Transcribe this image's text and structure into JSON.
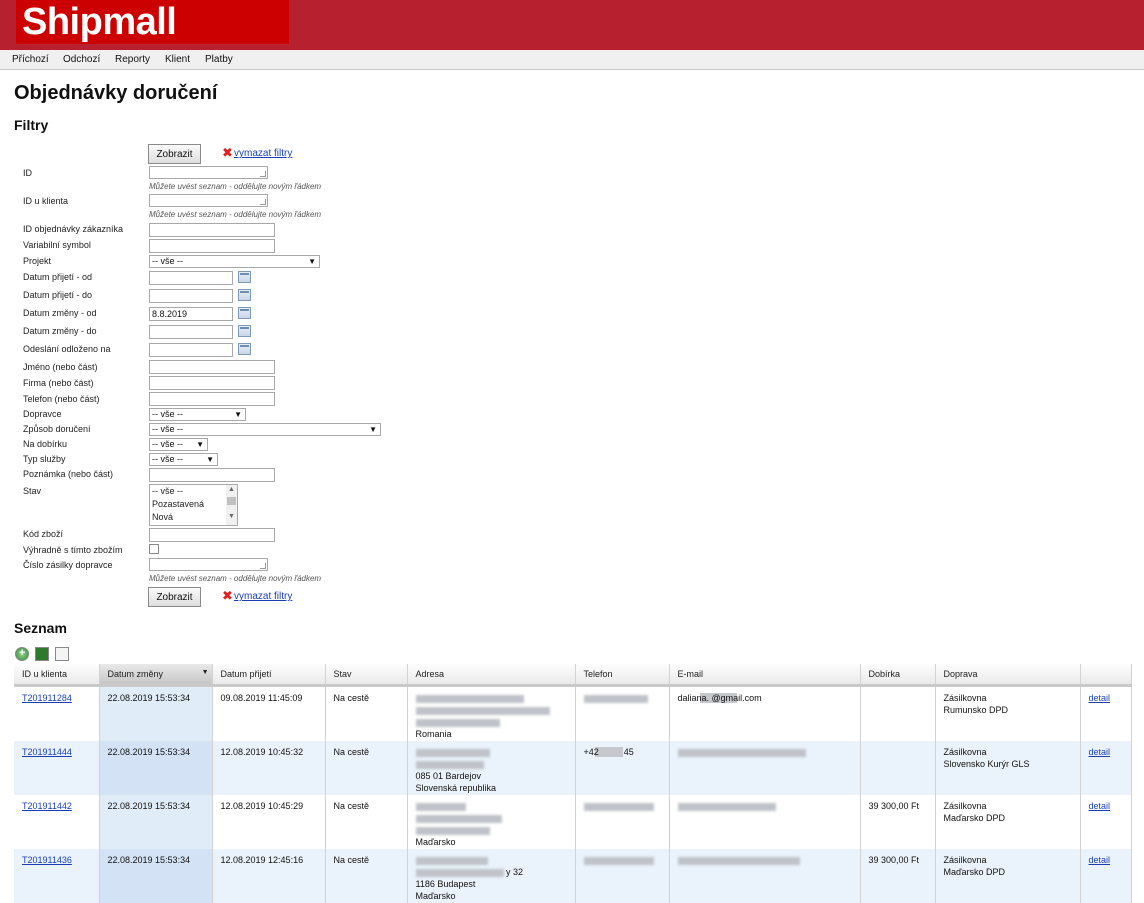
{
  "app": {
    "logo": "Shipmall"
  },
  "nav": [
    "Příchozí",
    "Odchozí",
    "Reporty",
    "Klient",
    "Platby"
  ],
  "page_title": "Objednávky doručení",
  "filters": {
    "heading": "Filtry",
    "show_button": "Zobrazit",
    "clear_link": "vymazat filtry",
    "list_hint": "Můžete uvést seznam - oddělujte novým řádkem",
    "labels": {
      "id": "ID",
      "client_id": "ID u klienta",
      "customer_order_id": "ID objednávky zákazníka",
      "variable_symbol": "Variabilní symbol",
      "project": "Projekt",
      "received_from": "Datum přijetí - od",
      "received_to": "Datum přijetí - do",
      "changed_from": "Datum změny - od",
      "changed_to": "Datum změny - do",
      "shipping_postponed": "Odeslání odloženo na",
      "name": "Jméno (nebo část)",
      "company": "Firma (nebo část)",
      "phone": "Telefon (nebo část)",
      "carrier": "Dopravce",
      "delivery_method": "Způsob doručení",
      "cod": "Na dobírku",
      "service_type": "Typ služby",
      "note": "Poznámka (nebo část)",
      "state": "Stav",
      "product_code": "Kód zboží",
      "only_this_product": "Výhradně s tímto zbožím",
      "tracking_number": "Číslo zásilky dopravce"
    },
    "values": {
      "changed_from": "8.8.2019",
      "select_all": "-- vše --"
    },
    "state_options": [
      "-- vše --",
      "Pozastavená",
      "Nová"
    ]
  },
  "list": {
    "heading": "Seznam",
    "columns": [
      "ID u klienta",
      "Datum změny",
      "Datum přijetí",
      "Stav",
      "Adresa",
      "Telefon",
      "E-mail",
      "Dobírka",
      "Doprava",
      ""
    ],
    "detail_label": "detail",
    "rows": [
      {
        "id": "T201911284",
        "changed": "22.08.2019 15:53:34",
        "received": "09.08.2019 11:45:09",
        "state": "Na cestě",
        "addr_visible": [
          "",
          "",
          "",
          "Romania"
        ],
        "phone": "",
        "email": "daliana.                 @gmail.com",
        "cod": "",
        "shipping": [
          "Zásilkovna",
          "Rumunsko DPD"
        ]
      },
      {
        "id": "T201911444",
        "changed": "22.08.2019 15:53:34",
        "received": "12.08.2019 10:45:32",
        "state": "Na cestě",
        "addr_visible": [
          "",
          "",
          "085 01 Bardejov",
          "Slovenská republika"
        ],
        "phone": "+42          45",
        "email": "",
        "cod": "",
        "shipping": [
          "Zásilkovna",
          "Slovensko Kurýr GLS"
        ]
      },
      {
        "id": "T201911442",
        "changed": "22.08.2019 15:53:34",
        "received": "12.08.2019 10:45:29",
        "state": "Na cestě",
        "addr_visible": [
          "",
          "",
          "",
          "Maďarsko"
        ],
        "phone": "",
        "email": "",
        "cod": "39 300,00 Ft",
        "shipping": [
          "Zásilkovna",
          "Maďarsko DPD"
        ]
      },
      {
        "id": "T201911436",
        "changed": "22.08.2019 15:53:34",
        "received": "12.08.2019 12:45:16",
        "state": "Na cestě",
        "addr_visible": [
          "",
          "y 32",
          "1186 Budapest",
          "Maďarsko"
        ],
        "phone": "",
        "email": "",
        "cod": "39 300,00 Ft",
        "shipping": [
          "Zásilkovna",
          "Maďarsko DPD"
        ]
      }
    ]
  }
}
